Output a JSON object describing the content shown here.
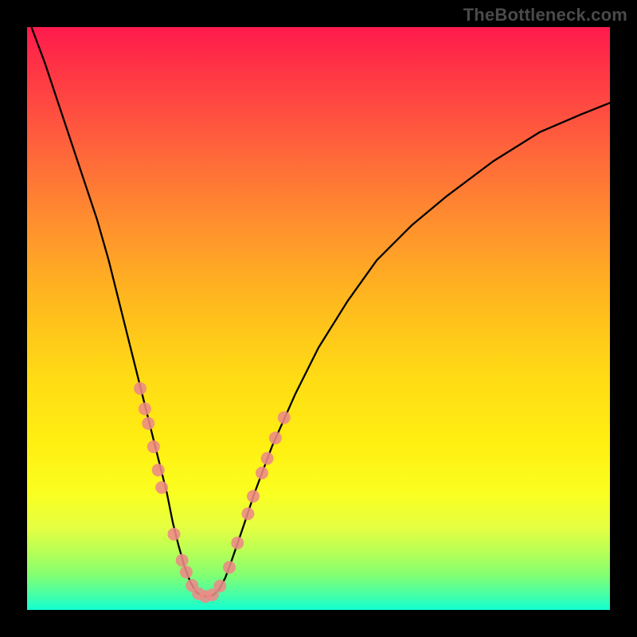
{
  "watermark": "TheBottleneck.com",
  "chart_data": {
    "type": "line",
    "title": "",
    "xlabel": "",
    "ylabel": "",
    "xlim": [
      0,
      100
    ],
    "ylim": [
      0,
      100
    ],
    "curve": {
      "name": "bottleneck-curve",
      "x": [
        0,
        3,
        6,
        9,
        12,
        14,
        16,
        18,
        19.5,
        21,
        22.5,
        24,
        25,
        26,
        27,
        28,
        29,
        30,
        31,
        32,
        33,
        34,
        35,
        37,
        39,
        42,
        46,
        50,
        55,
        60,
        66,
        72,
        80,
        88,
        95,
        100
      ],
      "y": [
        102,
        94,
        85,
        76,
        67,
        60,
        52,
        44,
        38,
        32,
        26,
        20,
        15,
        11,
        7.5,
        4.8,
        3.1,
        2.4,
        2.3,
        2.6,
        3.6,
        5.5,
        8.2,
        14,
        20,
        28,
        37,
        45,
        53,
        60,
        66,
        71,
        77,
        82,
        85,
        87
      ]
    },
    "markers": {
      "name": "highlight-points",
      "points": [
        {
          "x": 19.4,
          "y": 38
        },
        {
          "x": 20.2,
          "y": 34.5
        },
        {
          "x": 20.8,
          "y": 32
        },
        {
          "x": 21.7,
          "y": 28
        },
        {
          "x": 22.5,
          "y": 24
        },
        {
          "x": 23.1,
          "y": 21
        },
        {
          "x": 25.2,
          "y": 13
        },
        {
          "x": 26.6,
          "y": 8.5
        },
        {
          "x": 27.3,
          "y": 6.5
        },
        {
          "x": 28.3,
          "y": 4.2
        },
        {
          "x": 29.4,
          "y": 2.8
        },
        {
          "x": 30.6,
          "y": 2.3
        },
        {
          "x": 31.8,
          "y": 2.6
        },
        {
          "x": 33.1,
          "y": 4.1
        },
        {
          "x": 34.7,
          "y": 7.3
        },
        {
          "x": 36.1,
          "y": 11.5
        },
        {
          "x": 37.9,
          "y": 16.5
        },
        {
          "x": 38.8,
          "y": 19.5
        },
        {
          "x": 40.3,
          "y": 23.5
        },
        {
          "x": 41.2,
          "y": 26
        },
        {
          "x": 42.6,
          "y": 29.5
        },
        {
          "x": 44.1,
          "y": 33
        }
      ]
    }
  }
}
